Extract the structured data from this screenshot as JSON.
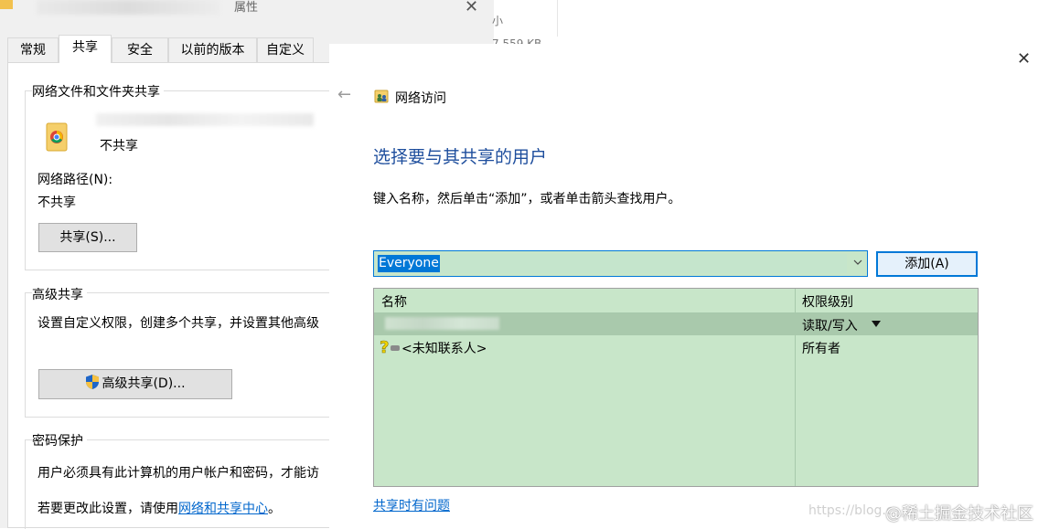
{
  "properties_window": {
    "title_suffix": "属性",
    "close_glyph": "✕",
    "tabs": [
      {
        "label": "常规"
      },
      {
        "label": "共享"
      },
      {
        "label": "安全"
      },
      {
        "label": "以前的版本"
      },
      {
        "label": "自定义"
      }
    ],
    "background_col_fragment": "小",
    "background_size_fragment": "7 559 KB",
    "network_sharing": {
      "group_title": "网络文件和文件夹共享",
      "folder_status": "不共享",
      "network_path_label": "网络路径(N):",
      "network_path_value": "不共享",
      "share_button": "共享(S)..."
    },
    "advanced_sharing": {
      "group_title": "高级共享",
      "description": "设置自定义权限，创建多个共享，并设置其他高级",
      "button": "高级共享(D)..."
    },
    "password_protection": {
      "group_title": "密码保护",
      "description": "用户必须具有此计算机的用户帐户和密码，才能访",
      "change_prefix": "若要更改此设置，请使用",
      "change_link": "网络和共享中心",
      "change_suffix": "。"
    }
  },
  "network_access": {
    "close_glyph": "✕",
    "back_glyph": "←",
    "title": "网络访问",
    "heading": "选择要与其共享的用户",
    "instruction": "键入名称，然后单击“添加”，或者单击箭头查找用户。",
    "user_input_value": "Everyone",
    "add_button": "添加(A)",
    "table": {
      "columns": [
        "名称",
        "权限级别"
      ],
      "rows": [
        {
          "name": "",
          "permission": "读取/写入"
        },
        {
          "name": "<未知联系人>",
          "permission": "所有者"
        }
      ]
    },
    "help_link": "共享时有问题"
  },
  "watermark": {
    "url_fragment": "https://blog.c",
    "text": "@稀土掘金技术社区"
  }
}
